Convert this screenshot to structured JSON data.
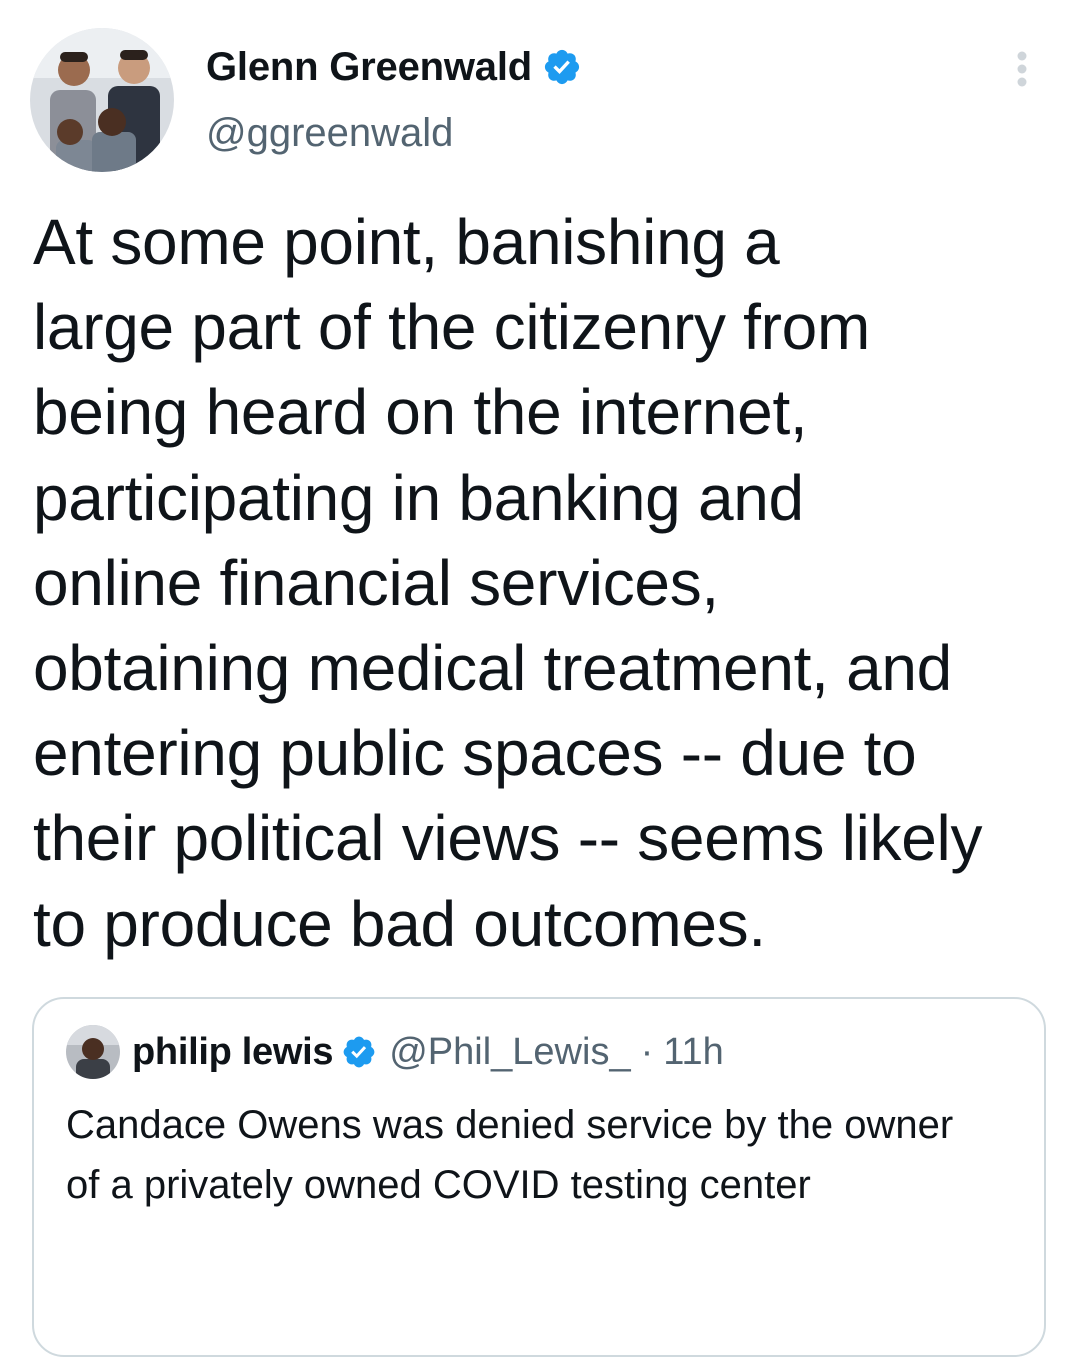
{
  "tweet": {
    "author": {
      "name": "Glenn Greenwald",
      "handle": "@ggreenwald",
      "verified": true,
      "avatar_icon": "profile-photo-group"
    },
    "text": "At some point, banishing a\nlarge part of the citizenry from\nbeing heard on the internet,\nparticipating in banking and\nonline financial services,\nobtaining medical treatment, and\nentering public spaces -- due to\ntheir political views -- seems likely\nto produce bad outcomes.",
    "more_icon": "more-vertical-icon"
  },
  "quoted_tweet": {
    "author": {
      "name": "philip lewis",
      "handle": "@Phil_Lewis_",
      "verified": true
    },
    "separator": "·",
    "time": "11h",
    "text": "Candace Owens was denied service by the\nowner of a privately owned COVID testing\ncenter"
  },
  "colors": {
    "text": "#0f1419",
    "secondary": "#536471",
    "verified_blue": "#1d9bf0",
    "border": "#cfd9de"
  }
}
